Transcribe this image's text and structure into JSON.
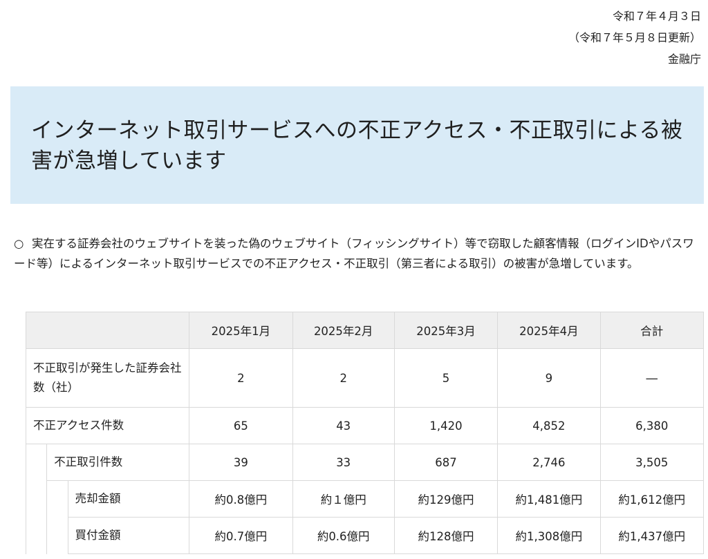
{
  "header": {
    "date": "令和７年４月３日",
    "updated": "（令和７年５月８日更新）",
    "agency": "金融庁"
  },
  "banner": {
    "title": "インターネット取引サービスへの不正アクセス・不正取引による被害が急増しています"
  },
  "intro": {
    "marker": "○",
    "text": "実在する証券会社のウェブサイトを装った偽のウェブサイト（フィッシングサイト）等で窃取した顧客情報（ログインIDやパスワード等）によるインターネット取引サービスでの不正アクセス・不正取引（第三者による取引）の被害が急増しています。"
  },
  "table": {
    "headers": [
      "",
      "2025年1月",
      "2025年2月",
      "2025年3月",
      "2025年4月",
      "合計"
    ],
    "rows": [
      {
        "label": "不正取引が発生した証券会社数（社）",
        "values": [
          "2",
          "2",
          "5",
          "9",
          "―"
        ]
      },
      {
        "label": "不正アクセス件数",
        "values": [
          "65",
          "43",
          "1,420",
          "4,852",
          "6,380"
        ]
      },
      {
        "label": "不正取引件数",
        "values": [
          "39",
          "33",
          "687",
          "2,746",
          "3,505"
        ]
      },
      {
        "label": "売却金額",
        "values": [
          "約0.8億円",
          "約１億円",
          "約129億円",
          "約1,481億円",
          "約1,612億円"
        ]
      },
      {
        "label": "買付金額",
        "values": [
          "約0.7億円",
          "約0.6億円",
          "約128億円",
          "約1,308億円",
          "約1,437億円"
        ]
      }
    ]
  }
}
